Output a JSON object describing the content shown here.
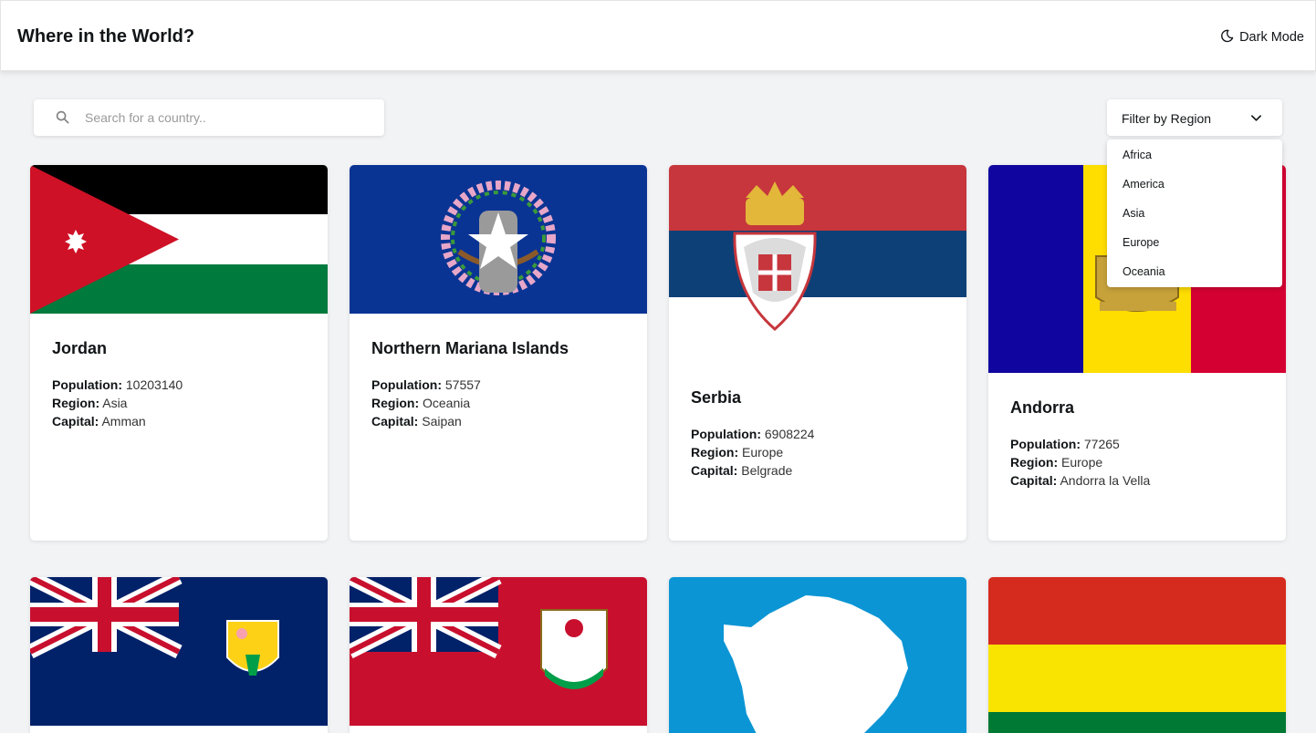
{
  "header": {
    "title": "Where in the World?",
    "dark_mode_label": "Dark Mode"
  },
  "search": {
    "placeholder": "Search for a country.."
  },
  "filter": {
    "label": "Filter by Region",
    "options": [
      "Africa",
      "America",
      "Asia",
      "Europe",
      "Oceania"
    ]
  },
  "labels": {
    "population": "Population:",
    "region": "Region:",
    "capital": "Capital:"
  },
  "cards": [
    {
      "name": "Jordan",
      "population": "10203140",
      "region": "Asia",
      "capital": "Amman",
      "flag": "jordan-flag"
    },
    {
      "name": "Northern Mariana Islands",
      "population": "57557",
      "region": "Oceania",
      "capital": "Saipan",
      "flag": "northern-mariana-islands-flag"
    },
    {
      "name": "Serbia",
      "population": "6908224",
      "region": "Europe",
      "capital": "Belgrade",
      "flag": "serbia-flag"
    },
    {
      "name": "Andorra",
      "population": "77265",
      "region": "Europe",
      "capital": "Andorra la Vella",
      "flag": "andorra-flag"
    },
    {
      "name": "",
      "flag": "turks-and-caicos-flag"
    },
    {
      "name": "",
      "flag": "bermuda-flag"
    },
    {
      "name": "",
      "flag": "antarctica-flag"
    },
    {
      "name": "",
      "flag": "bolivia-flag"
    }
  ],
  "colors": {
    "background": "#f2f3f5",
    "surface": "#ffffff",
    "text": "#111517"
  }
}
